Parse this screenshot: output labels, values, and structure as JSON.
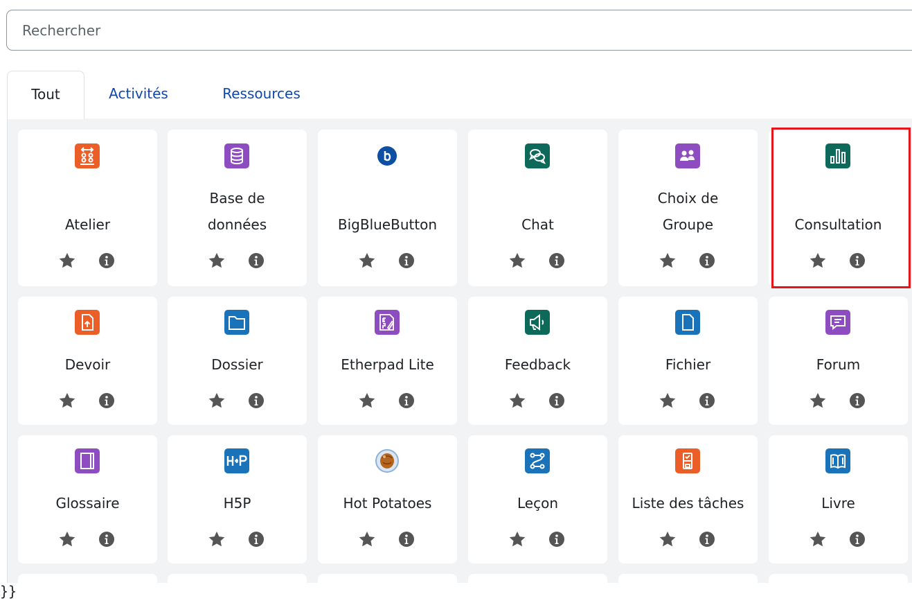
{
  "search": {
    "placeholder": "Rechercher"
  },
  "tabs": [
    {
      "label": "Tout",
      "active": true
    },
    {
      "label": "Activités",
      "active": false
    },
    {
      "label": "Ressources",
      "active": false
    }
  ],
  "modules": [
    {
      "label": "Atelier",
      "icon": "atelier-icon",
      "color": "#ec5e27"
    },
    {
      "label": "Base de données",
      "icon": "database-icon",
      "color": "#8d4cc0"
    },
    {
      "label": "BigBlueButton",
      "icon": "bigbluebutton-icon",
      "color": "#0e4ea3"
    },
    {
      "label": "Chat",
      "icon": "chat-icon",
      "color": "#0d6a5a"
    },
    {
      "label": "Choix de Groupe",
      "icon": "group-choice-icon",
      "color": "#8d4cc0"
    },
    {
      "label": "Consultation",
      "icon": "consultation-icon",
      "color": "#0d6a5a"
    },
    {
      "label": "Devoir",
      "icon": "assignment-icon",
      "color": "#ec5e27"
    },
    {
      "label": "Dossier",
      "icon": "folder-icon",
      "color": "#1a73b8"
    },
    {
      "label": "Etherpad Lite",
      "icon": "etherpad-icon",
      "color": "#8d4cc0"
    },
    {
      "label": "Feedback",
      "icon": "feedback-icon",
      "color": "#0d6a5a"
    },
    {
      "label": "Fichier",
      "icon": "file-icon",
      "color": "#1a73b8"
    },
    {
      "label": "Forum",
      "icon": "forum-icon",
      "color": "#8d4cc0"
    },
    {
      "label": "Glossaire",
      "icon": "glossary-icon",
      "color": "#8d4cc0"
    },
    {
      "label": "H5P",
      "icon": "h5p-icon",
      "color": "#1a73b8"
    },
    {
      "label": "Hot Potatoes",
      "icon": "hotpotatoes-icon",
      "color": "#d9843a"
    },
    {
      "label": "Leçon",
      "icon": "lesson-icon",
      "color": "#1a73b8"
    },
    {
      "label": "Liste des tâches",
      "icon": "checklist-icon",
      "color": "#ec5e27"
    },
    {
      "label": "Livre",
      "icon": "book-icon",
      "color": "#1a73b8"
    }
  ],
  "highlighted_module": "Consultation",
  "stray_text": "}}"
}
